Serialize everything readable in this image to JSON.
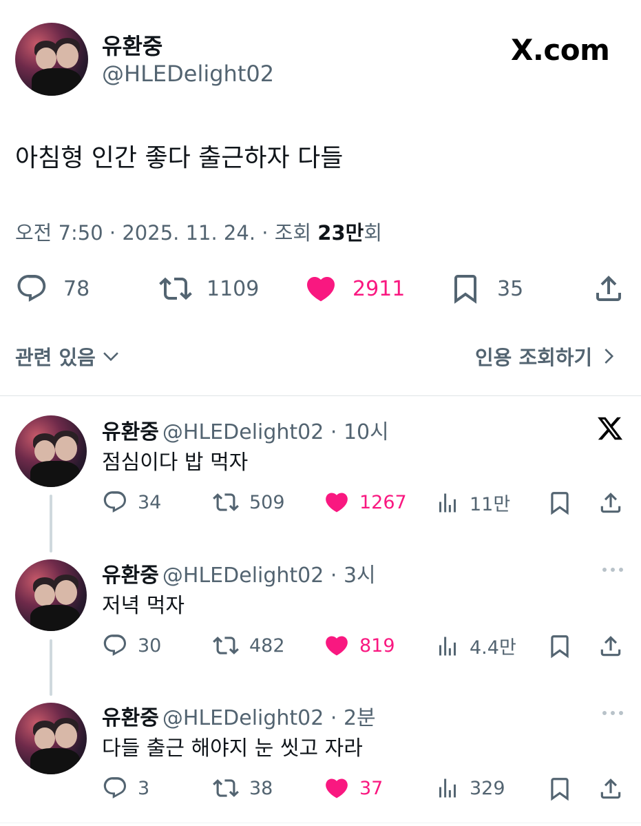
{
  "main_tweet": {
    "author_name": "유환중",
    "handle": "@HLEDelight02",
    "site_logo": "X.com",
    "text": "아침형 인간 좋다 출근하자 다들",
    "timestamp": "오전 7:50 · 2025. 11. 24. · 조회 ",
    "views_count": "23만",
    "views_suffix": "회",
    "metrics": {
      "replies": "78",
      "retweets": "1109",
      "likes": "2911",
      "bookmarks": "35"
    },
    "related_label": "관련 있음",
    "quotes_label": "인용 조회하기"
  },
  "replies": [
    {
      "name": "유환중",
      "handle_time": "@HLEDelight02 · 10시",
      "text": "점심이다 밥 먹자",
      "replies": "34",
      "retweets": "509",
      "likes": "1267",
      "views": "11만",
      "corner_icon": "x-logo-icon"
    },
    {
      "name": "유환중",
      "handle_time": "@HLEDelight02 · 3시",
      "text": "저녁 먹자",
      "replies": "30",
      "retweets": "482",
      "likes": "819",
      "views": "4.4만",
      "corner_icon": "more-icon"
    },
    {
      "name": "유환중",
      "handle_time": "@HLEDelight02 · 2분",
      "text": "다들 출근 해야지 눈 씻고 자라",
      "replies": "3",
      "retweets": "38",
      "likes": "37",
      "views": "329",
      "corner_icon": "more-icon"
    }
  ],
  "colors": {
    "like_pink": "#f91880",
    "secondary_gray": "#536471",
    "text_primary": "#0f1419",
    "thread_line": "#cfd9de"
  }
}
